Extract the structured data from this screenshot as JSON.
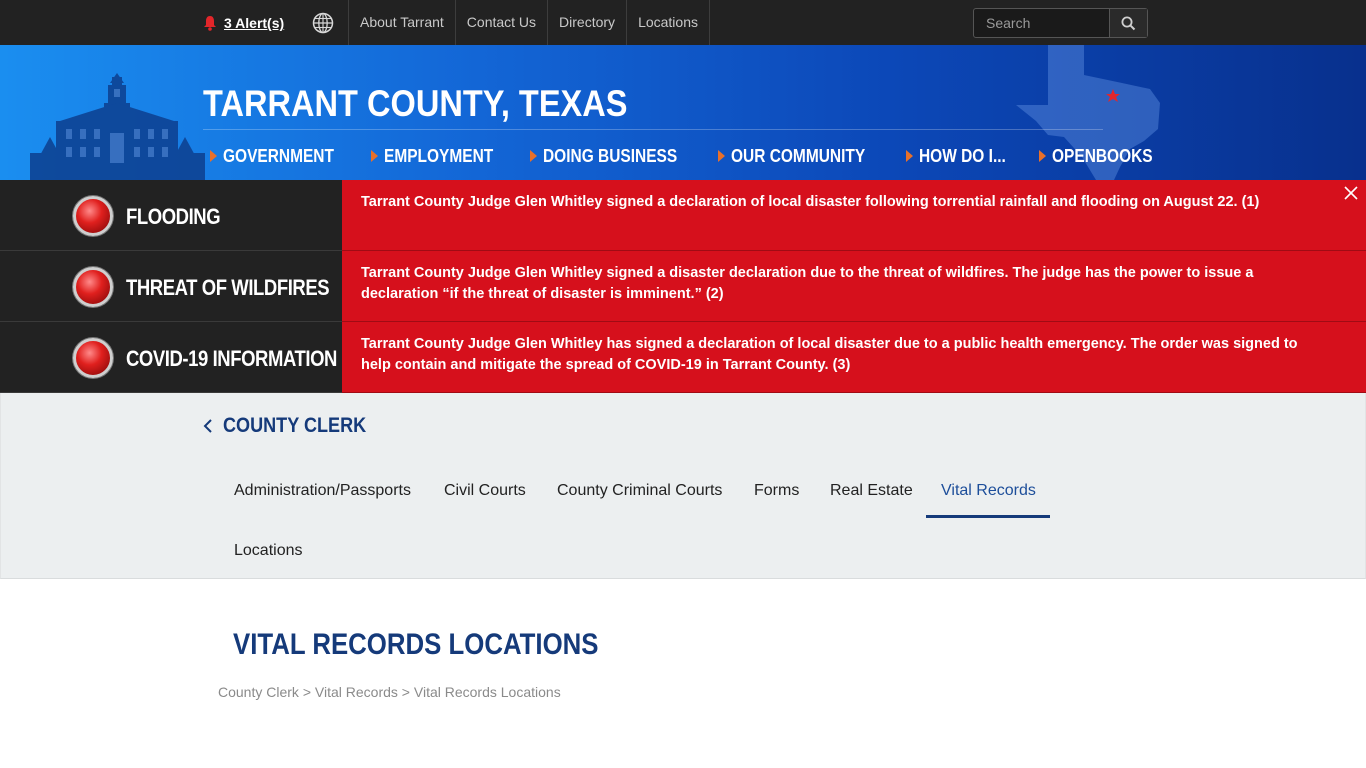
{
  "topbar": {
    "alerts_label": "3 Alert(s)",
    "links": [
      "About Tarrant",
      "Contact Us",
      "Directory",
      "Locations"
    ],
    "search_placeholder": "Search"
  },
  "header": {
    "site_title": "TARRANT COUNTY, TEXAS",
    "nav": [
      "GOVERNMENT",
      "EMPLOYMENT",
      "DOING BUSINESS",
      "OUR COMMUNITY",
      "HOW DO I...",
      "OPENBOOKS"
    ]
  },
  "alerts": [
    {
      "title": "FLOODING",
      "text": "Tarrant County Judge Glen Whitley signed a declaration of local disaster following torrential rainfall and flooding on August 22. (1)"
    },
    {
      "title": "THREAT OF WILDFIRES",
      "text": "Tarrant County Judge Glen Whitley signed a disaster declaration due to the threat of wildfires. The judge has the power to issue a declaration “if the threat of disaster is imminent.” (2)"
    },
    {
      "title": "COVID-19 INFORMATION",
      "text": "Tarrant County Judge Glen Whitley has signed a declaration of local disaster due to a public health emergency. The order was signed to help contain and mitigate the spread of COVID-19 in Tarrant County. (3)"
    }
  ],
  "section": {
    "back_label": "COUNTY CLERK",
    "tabs": [
      "Administration/Passports",
      "Civil Courts",
      "County Criminal Courts",
      "Forms",
      "Real Estate",
      "Vital Records",
      "Locations"
    ],
    "active_tab": "Vital Records"
  },
  "main": {
    "page_title": "VITAL RECORDS LOCATIONS",
    "breadcrumb": [
      "County Clerk",
      "Vital Records",
      "Vital Records Locations"
    ],
    "breadcrumb_separator": ">"
  },
  "colors": {
    "alert_red": "#d6101c",
    "brand_navy": "#153a7a",
    "accent_orange": "#e8702a"
  }
}
